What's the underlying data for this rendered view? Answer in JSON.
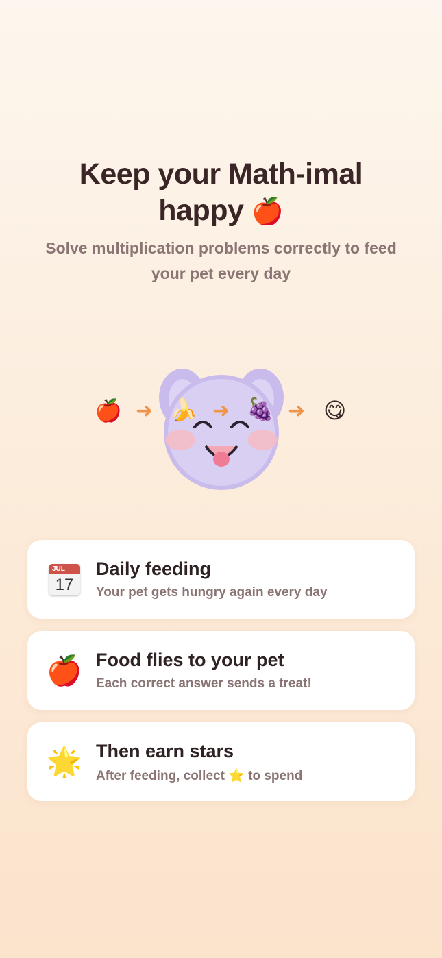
{
  "header": {
    "title_line1": "Keep your Math-imal",
    "title_line2": "happy",
    "title_emoji": "🍎",
    "subtitle": "Solve multiplication problems correctly to feed your pet every day"
  },
  "feeding_sequence": {
    "items": [
      "🍎",
      "🍌",
      "🍇",
      "😋"
    ],
    "arrow": "➜"
  },
  "pet": {
    "body_color": "#d3c7ee",
    "ear_outer_color": "#c5b7ea",
    "cheek_color": "#f5bcc6",
    "tongue_color": "#f07b95"
  },
  "cards": [
    {
      "icon": "calendar-icon",
      "calendar_month": "JUL",
      "calendar_day": "17",
      "title": "Daily feeding",
      "description": "Your pet gets hungry again every day"
    },
    {
      "icon": "apple-icon",
      "icon_glyph": "🍎",
      "title": "Food flies to your pet",
      "description": "Each correct answer sends a treat!"
    },
    {
      "icon": "glowing-star-icon",
      "icon_glyph": "🌟",
      "title": "Then earn stars",
      "description_before": "After feeding, collect",
      "description_icon": "⭐",
      "description_after": "to spend"
    }
  ],
  "colors": {
    "background_top": "#fdf6ee",
    "background_bottom": "#fbe3cc",
    "title": "#3a2626",
    "subtitle": "#8a7474",
    "arrow": "#f0944a",
    "card": "#ffffff"
  }
}
